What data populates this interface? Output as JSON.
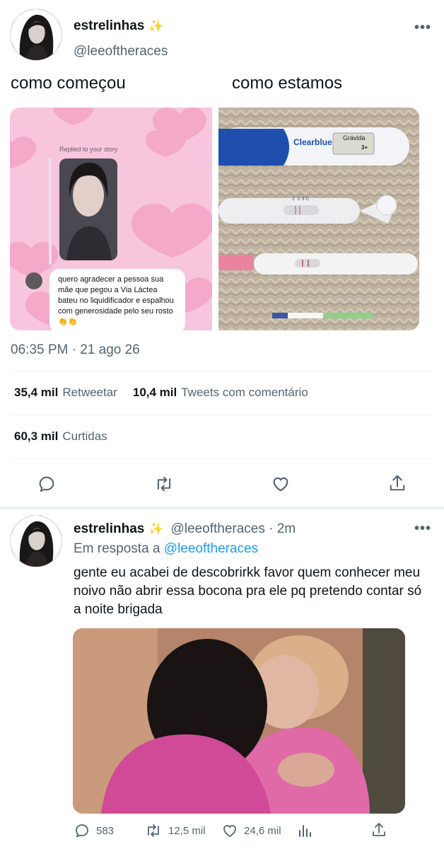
{
  "main_tweet": {
    "display_name": "estrelinhas",
    "sparkle": "✨",
    "handle": "@leeoftheraces",
    "more": "•••",
    "caption_left": "como começou",
    "caption_right": "como estamos",
    "story": {
      "replied_label": "Replied to your story",
      "message": "quero agradecer a pessoa sua mãe que pegou a Via Láctea bateu no liquidificador e espalhou com generosidade pelo seu rosto 👏👏"
    },
    "test_labels": {
      "brand": "Clearblue",
      "result": "Grávida",
      "weeks": "3+",
      "marks": "1  2 3 C"
    },
    "timestamp": "06:35 PM · 21 ago 26",
    "stats": {
      "retweets": "35,4 mil",
      "retweets_label": "Retweetar",
      "quotes": "10,4 mil",
      "quotes_label": "Tweets com comentário",
      "likes": "60,3 mil",
      "likes_label": "Curtidas"
    }
  },
  "reply_tweet": {
    "display_name": "estrelinhas",
    "sparkle": "✨",
    "handle_time": "@leeoftheraces · 2m",
    "more": "•••",
    "reply_prefix": "Em resposta a",
    "reply_mention": "@leeoftheraces",
    "text": "gente eu acabei de descobrirkk favor quem conhecer meu noivo não abrir essa bocona pra ele pq pretendo contar só a noite brigada",
    "counts": {
      "replies": "583",
      "retweets": "12,5 mil",
      "likes": "24,6 mil"
    }
  },
  "colors": {
    "accent": "#1d9bf0",
    "secondary_text": "#536471",
    "primary_text": "#0f1419",
    "divider": "#eff3f4",
    "story_pink": "#f7c6dc"
  },
  "icons": [
    "more-icon",
    "sparkle-icon",
    "reply-icon",
    "retweet-icon",
    "like-icon",
    "share-icon",
    "analytics-icon"
  ]
}
